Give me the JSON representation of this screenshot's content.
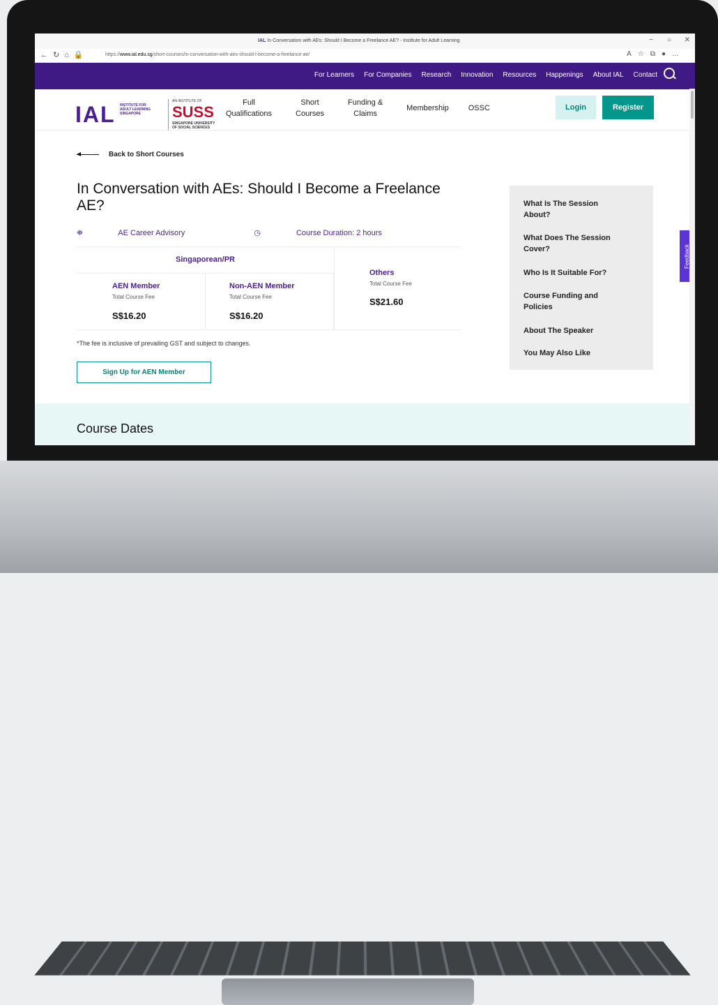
{
  "browser": {
    "tab_logo": "IAL",
    "tab_title": "In Conversation with AEs: Should I Become a Freelance AE? - Institute for Adult Learning",
    "url_prefix": "https://",
    "url_domain": "www.ial.edu.sg",
    "url_path": "/short-courses/in-conversation-with-aes-should-i-become-a-freelance-ae/"
  },
  "top_nav": [
    "For Learners",
    "For Companies",
    "Research",
    "Innovation",
    "Resources",
    "Happenings",
    "About IAL",
    "Contact"
  ],
  "logo": {
    "ial": "IAL",
    "ial_sub": [
      "INSTITUTE FOR",
      "ADULT LEARNING",
      "SINGAPORE"
    ],
    "suss_top": "AN INSTITUTE OF",
    "suss": "SUSS",
    "suss_sub": [
      "SINGAPORE UNIVERSITY",
      "OF SOCIAL SCIENCES"
    ]
  },
  "main_nav": [
    {
      "line1": "Full",
      "line2": "Qualifications"
    },
    {
      "line1": "Short",
      "line2": "Courses"
    },
    {
      "line1": "Funding &",
      "line2": "Claims"
    },
    {
      "line1": "Membership",
      "line2": ""
    },
    {
      "line1": "OSSC",
      "line2": ""
    }
  ],
  "buttons": {
    "login": "Login",
    "register": "Register",
    "signup": "Sign Up for AEN Member"
  },
  "back_link": "Back to Short Courses",
  "course": {
    "title": "In Conversation with AEs: Should I Become a Freelance AE?",
    "category": "AE Career Advisory",
    "duration": "Course Duration: 2 hours"
  },
  "fees": {
    "group": "Singaporean/PR",
    "aen": {
      "name": "AEN Member",
      "label": "Total Course Fee",
      "price": "S$16.20"
    },
    "non_aen": {
      "name": "Non-AEN Member",
      "label": "Total Course Fee",
      "price": "S$16.20"
    },
    "others": {
      "name": "Others",
      "label": "Total Course Fee",
      "price": "S$21.60"
    },
    "note": "*The fee is inclusive of prevailing GST and subject to changes."
  },
  "sidebar": [
    [
      "What Is The Session",
      "About?"
    ],
    [
      "What Does The Session",
      "Cover?"
    ],
    [
      "Who Is It Suitable For?"
    ],
    [
      "Course Funding and",
      "Policies"
    ],
    [
      "About The Speaker"
    ],
    [
      "You May Also Like"
    ]
  ],
  "feedback": "Feedback",
  "section_heading": "Course Dates"
}
